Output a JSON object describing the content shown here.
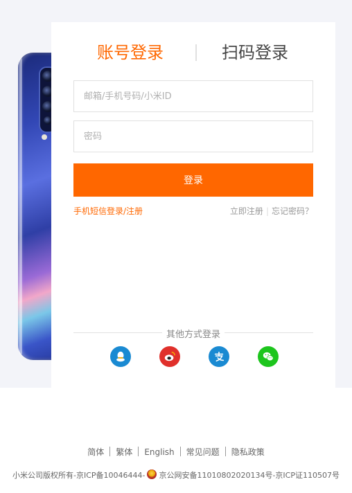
{
  "tabs": {
    "account_login": "账号登录",
    "qr_login": "扫码登录"
  },
  "form": {
    "account_placeholder": "邮箱/手机号码/小米ID",
    "password_placeholder": "密码",
    "submit_label": "登录"
  },
  "links": {
    "sms_login": "手机短信登录/注册",
    "register_now": "立即注册",
    "forgot_password": "忘记密码？"
  },
  "other_login": {
    "label": "其他方式登录",
    "providers": [
      {
        "icon": "qq-icon",
        "color": "#1a8ad2"
      },
      {
        "icon": "weibo-icon",
        "color": "#e0302b"
      },
      {
        "icon": "alipay-icon",
        "color": "#1a8ad2"
      },
      {
        "icon": "wechat-icon",
        "color": "#1dc51d"
      }
    ]
  },
  "footer": {
    "nav": [
      "简体",
      "繁体",
      "English",
      "常见问题",
      "隐私政策"
    ],
    "copyright_left": "小米公司版权所有-京ICP备10046444-",
    "copyright_right": "京公网安备11010802020134号-京ICP证110507号"
  },
  "colors": {
    "accent": "#ff6700",
    "background": "#f3f4f9"
  }
}
